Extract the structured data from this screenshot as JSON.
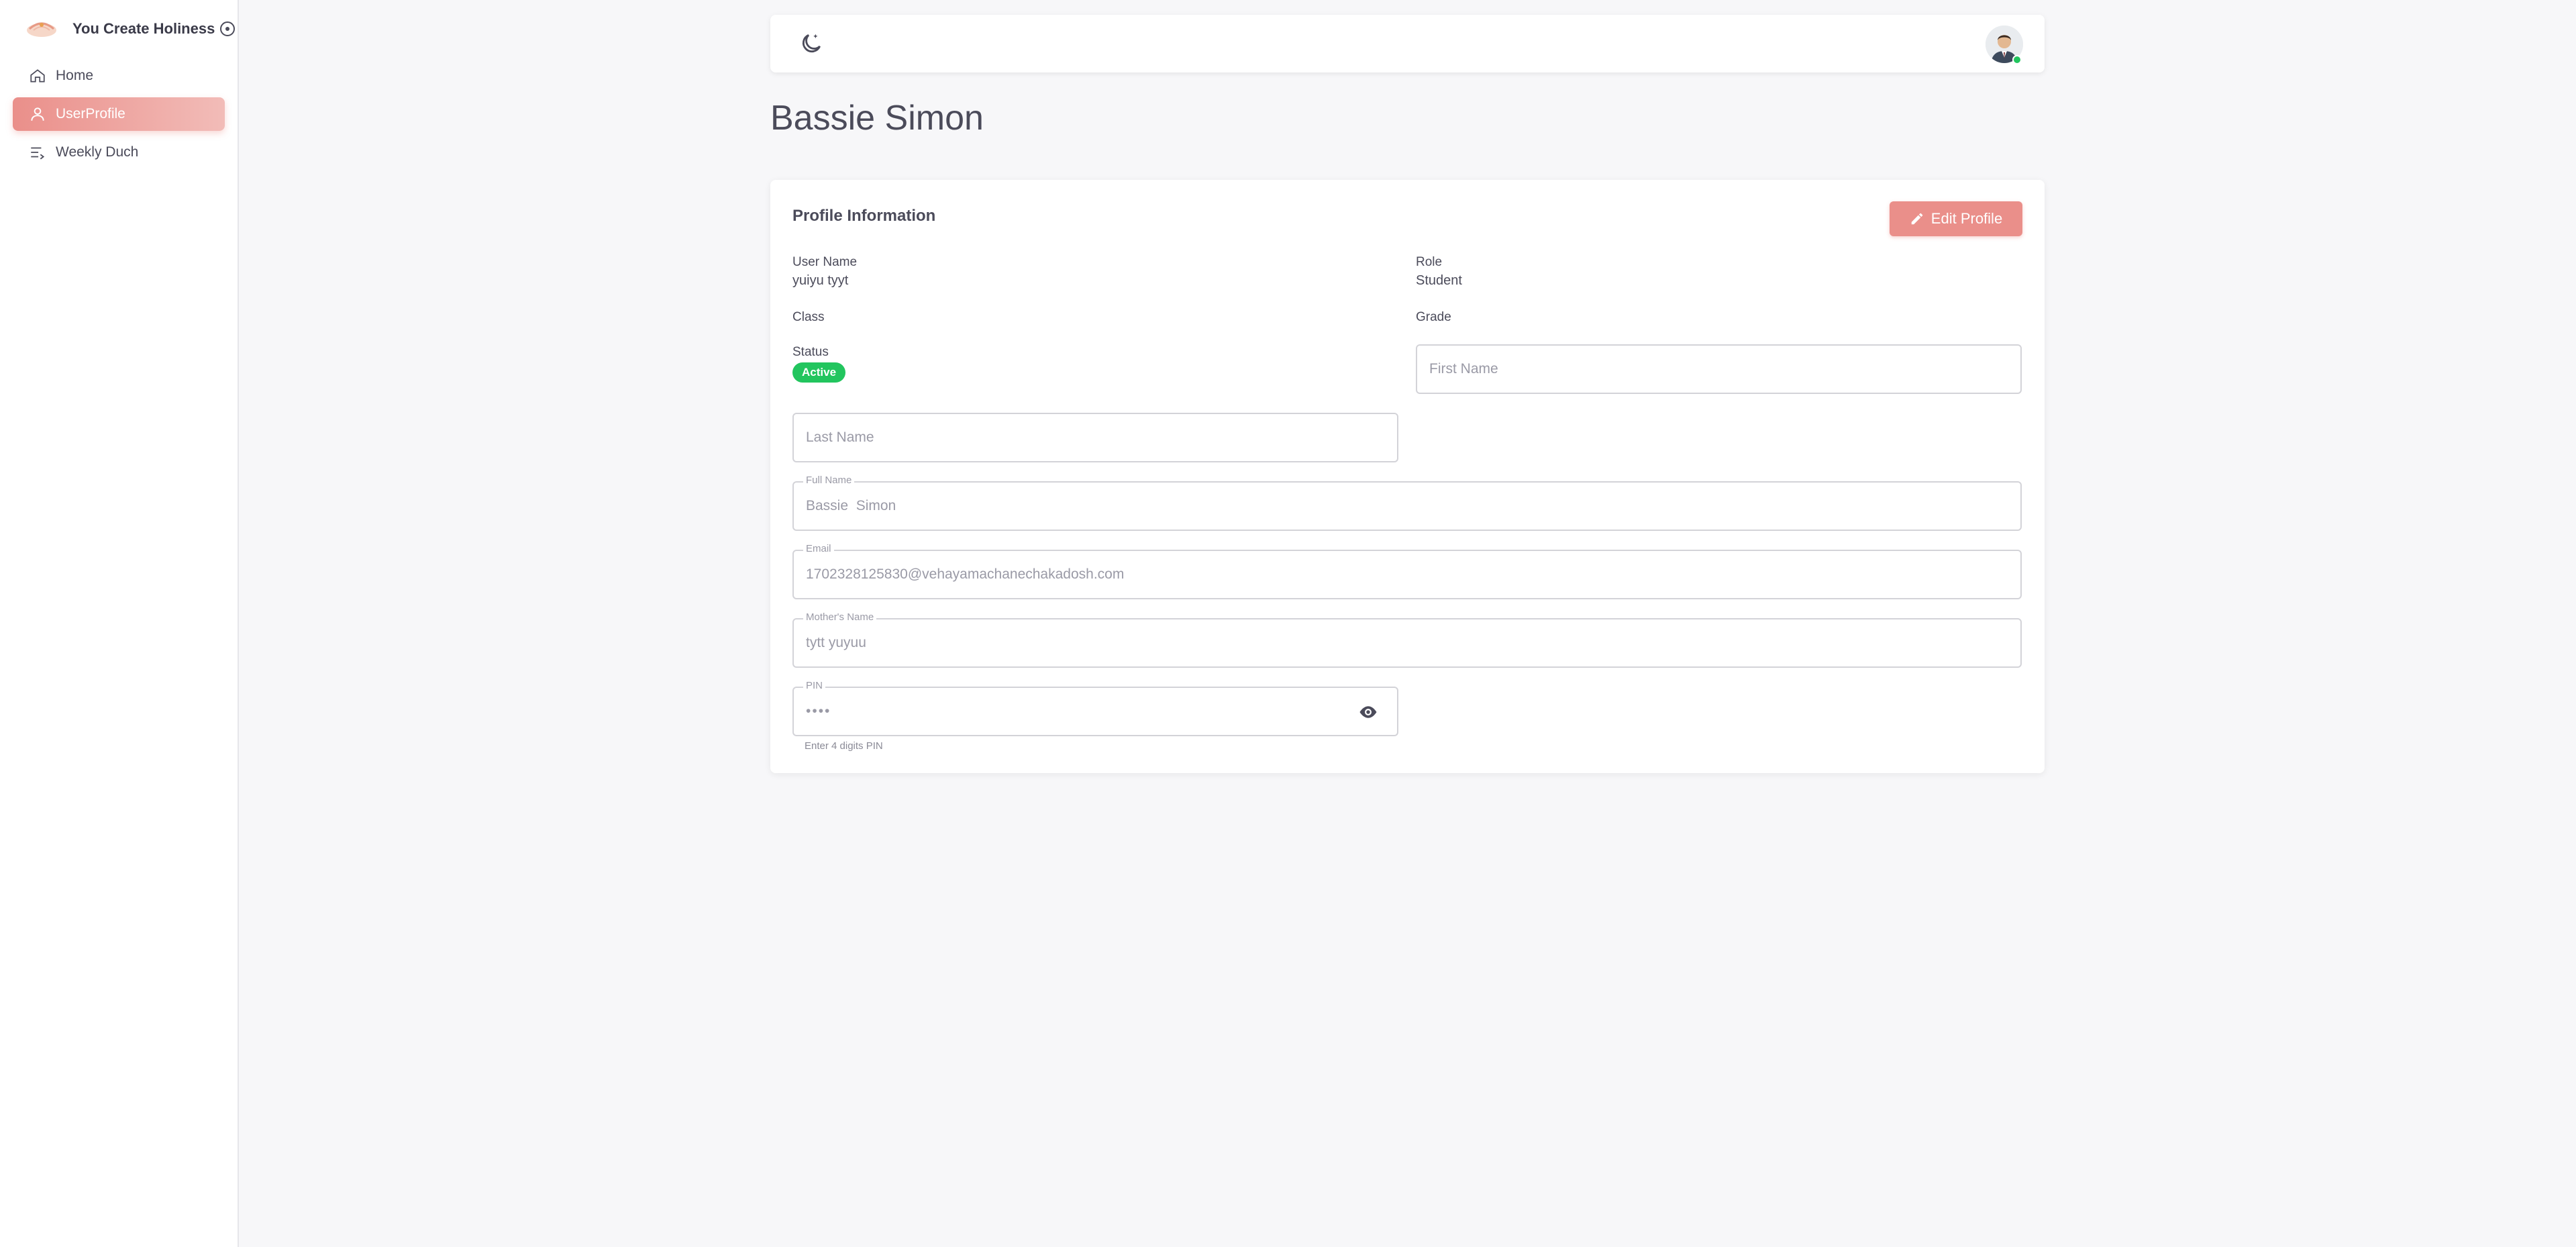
{
  "app": {
    "title": "You Create Holiness"
  },
  "sidebar": {
    "items": [
      {
        "label": "Home",
        "icon": "home-icon",
        "active": false
      },
      {
        "label": "UserProfile",
        "icon": "user-icon",
        "active": true
      },
      {
        "label": "Weekly Duch",
        "icon": "list-arrow-icon",
        "active": false
      }
    ]
  },
  "topbar": {
    "theme_icon": "moon-icon",
    "avatar_status": "online"
  },
  "page": {
    "title": "Bassie Simon"
  },
  "profile": {
    "card_title": "Profile Information",
    "edit_label": "Edit Profile",
    "username_label": "User Name",
    "username_value": "yuiyu tyyt",
    "role_label": "Role",
    "role_value": "Student",
    "class_label": "Class",
    "grade_label": "Grade",
    "status_label": "Status",
    "status_value": "Active",
    "first_name_placeholder": "First Name",
    "last_name_placeholder": "Last Name",
    "full_name_label": "Full Name",
    "full_name_value": "Bassie  Simon",
    "email_label": "Email",
    "email_value": "1702328125830@vehayamachanechakadosh.com",
    "mother_label": "Mother's Name",
    "mother_value": "tytt yuyuu",
    "pin_label": "PIN",
    "pin_value": "••••",
    "pin_helper": "Enter 4 digits PIN"
  },
  "colors": {
    "accent": "#ea8f8a",
    "status_active": "#22c55e",
    "background": "#f7f7f9"
  }
}
